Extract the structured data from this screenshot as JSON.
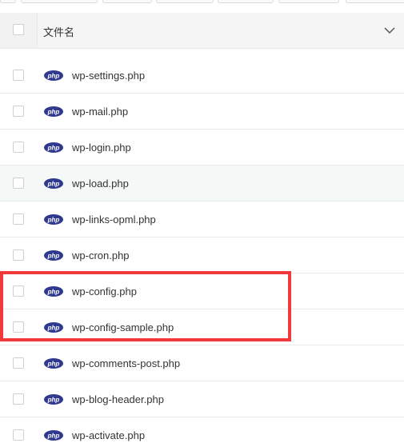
{
  "header": {
    "column_label": "文件名",
    "sort_icon": "chevron-down-icon"
  },
  "file_icon": "php-file-icon",
  "files": [
    {
      "name": "wp-settings.php"
    },
    {
      "name": "wp-mail.php"
    },
    {
      "name": "wp-login.php"
    },
    {
      "name": "wp-load.php"
    },
    {
      "name": "wp-links-opml.php"
    },
    {
      "name": "wp-cron.php"
    },
    {
      "name": "wp-config.php"
    },
    {
      "name": "wp-config-sample.php"
    },
    {
      "name": "wp-comments-post.php"
    },
    {
      "name": "wp-blog-header.php"
    },
    {
      "name": "wp-activate.php"
    }
  ],
  "php_icon_text": "php",
  "colors": {
    "highlight_border": "#f23a3a",
    "php_badge": "#2f3a8f",
    "hover_row": "#f4f9f8"
  }
}
